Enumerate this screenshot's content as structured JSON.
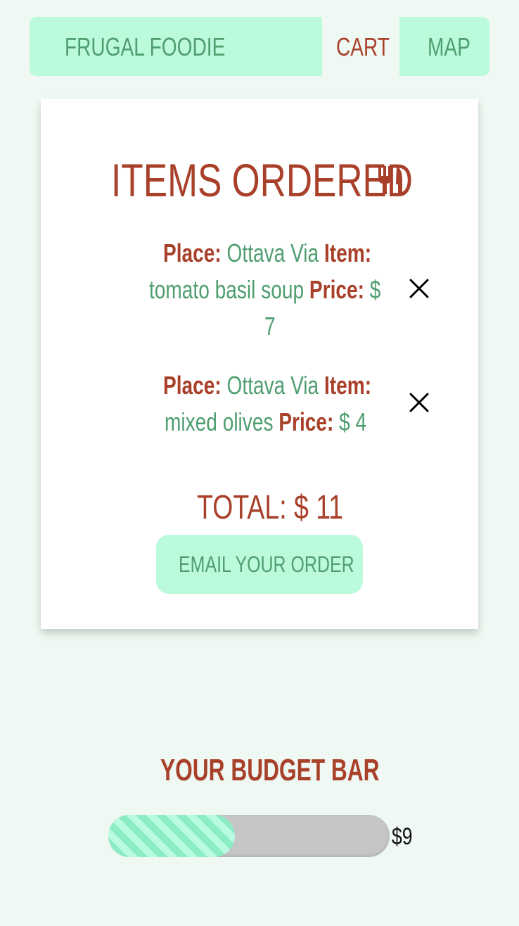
{
  "nav": {
    "brand": "FRUGAL FOODIE",
    "cart": "CART",
    "map": "MAP"
  },
  "cart": {
    "title": "ITEMS ORDERED",
    "title_icon": "utensils-icon",
    "place_label": "Place:",
    "item_label": "Item:",
    "price_label": "Price:",
    "items": [
      {
        "place": "Ottava Via",
        "item": "tomato basil soup",
        "price_prefix": "$",
        "price": "7",
        "remove_icon": "close-icon"
      },
      {
        "place": "Ottava Via",
        "item": "mixed olives",
        "price_prefix": "$",
        "price": "4",
        "remove_icon": "close-icon"
      }
    ],
    "total_label": "TOTAL:",
    "total_value": "$ 11",
    "email_button": "EMAIL YOUR ORDER"
  },
  "budget": {
    "title": "YOUR BUDGET BAR",
    "amount": "$9",
    "fill_fraction": 0.45
  },
  "colors": {
    "background": "#eff8f2",
    "accent_mint": "#bcfadc",
    "green_text": "#4f9e70",
    "red_text": "#a8402a",
    "bar_track": "#c6c6c6"
  }
}
